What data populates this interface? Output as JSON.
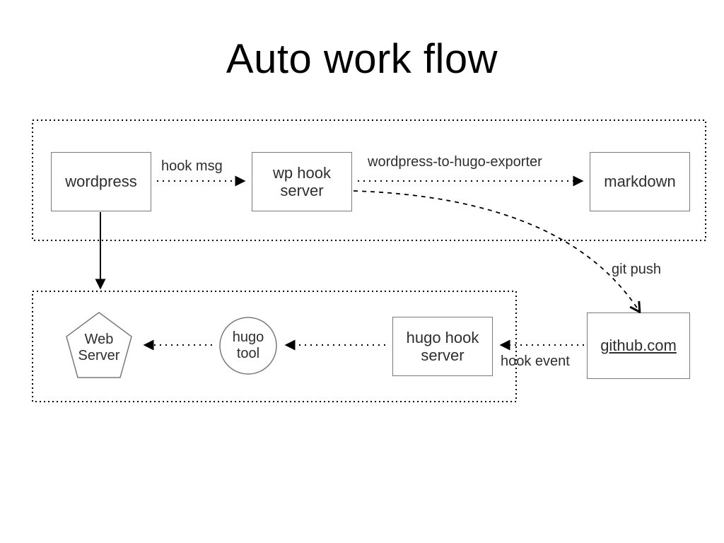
{
  "title": "Auto work flow",
  "nodes": {
    "wordpress": "wordpress",
    "wp_hook_server": "wp hook\nserver",
    "markdown": "markdown",
    "github": "github.com",
    "hugo_hook_server": "hugo hook\nserver",
    "hugo_tool": "hugo\ntool",
    "web_server": "Web\nServer"
  },
  "edges": {
    "hook_msg": "hook msg",
    "wp_to_hugo_exporter": "wordpress-to-hugo-exporter",
    "git_push": "git push",
    "hook_event": "hook event"
  }
}
